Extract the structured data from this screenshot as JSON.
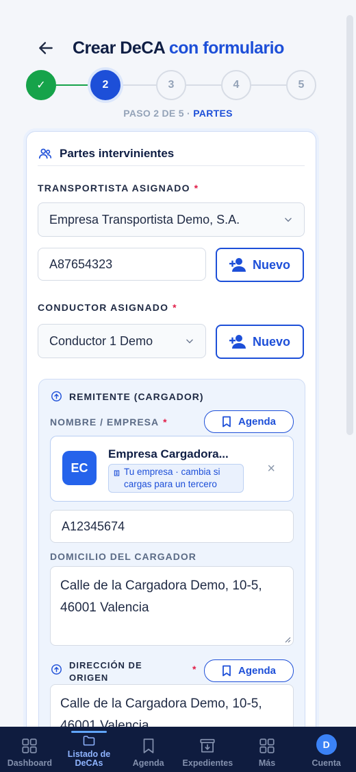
{
  "header": {
    "title_main": "Crear DeCA",
    "title_accent": "con formulario"
  },
  "stepper": {
    "steps": [
      "✓",
      "2",
      "3",
      "4",
      "5"
    ],
    "caption_prefix": "PASO 2 DE 5 ·",
    "caption_section": "PARTES"
  },
  "card": {
    "title": "Partes intervinientes",
    "carrier": {
      "label": "TRANSPORTISTA ASIGNADO",
      "required_mark": "*",
      "selected": "Empresa Transportista Demo, S.A.",
      "tax_id": "A87654323",
      "new_label": "Nuevo"
    },
    "driver": {
      "label": "CONDUCTOR ASIGNADO",
      "required_mark": "*",
      "selected": "Conductor 1 Demo",
      "new_label": "Nuevo"
    },
    "shipper": {
      "section_title": "REMITENTE (CARGADOR)",
      "name_label": "NOMBRE / EMPRESA",
      "required_mark": "*",
      "agenda_label": "Agenda",
      "company_initials": "EC",
      "company_name": "Empresa Cargadora...",
      "company_badge": "Tu empresa · cambia si cargas para un tercero",
      "tax_id": "A12345674",
      "address_label": "DOMICILIO DEL CARGADOR",
      "address": "Calle de la Cargadora Demo, 10-5, 46001 Valencia",
      "origin_label": "DIRECCIÓN DE ORIGEN",
      "origin_required": "*",
      "origin_agenda_label": "Agenda",
      "origin_address": "Calle de la Cargadora Demo, 10-5, 46001 Valencia"
    }
  },
  "nav": {
    "items": [
      "Dashboard",
      "Listado de DeCAs",
      "Agenda",
      "Expedientes",
      "Más",
      "Cuenta"
    ],
    "account_initial": "D"
  },
  "colors": {
    "accent": "#1d4fd8",
    "success": "#16a34a",
    "nav_bg": "#0f1c3f"
  }
}
